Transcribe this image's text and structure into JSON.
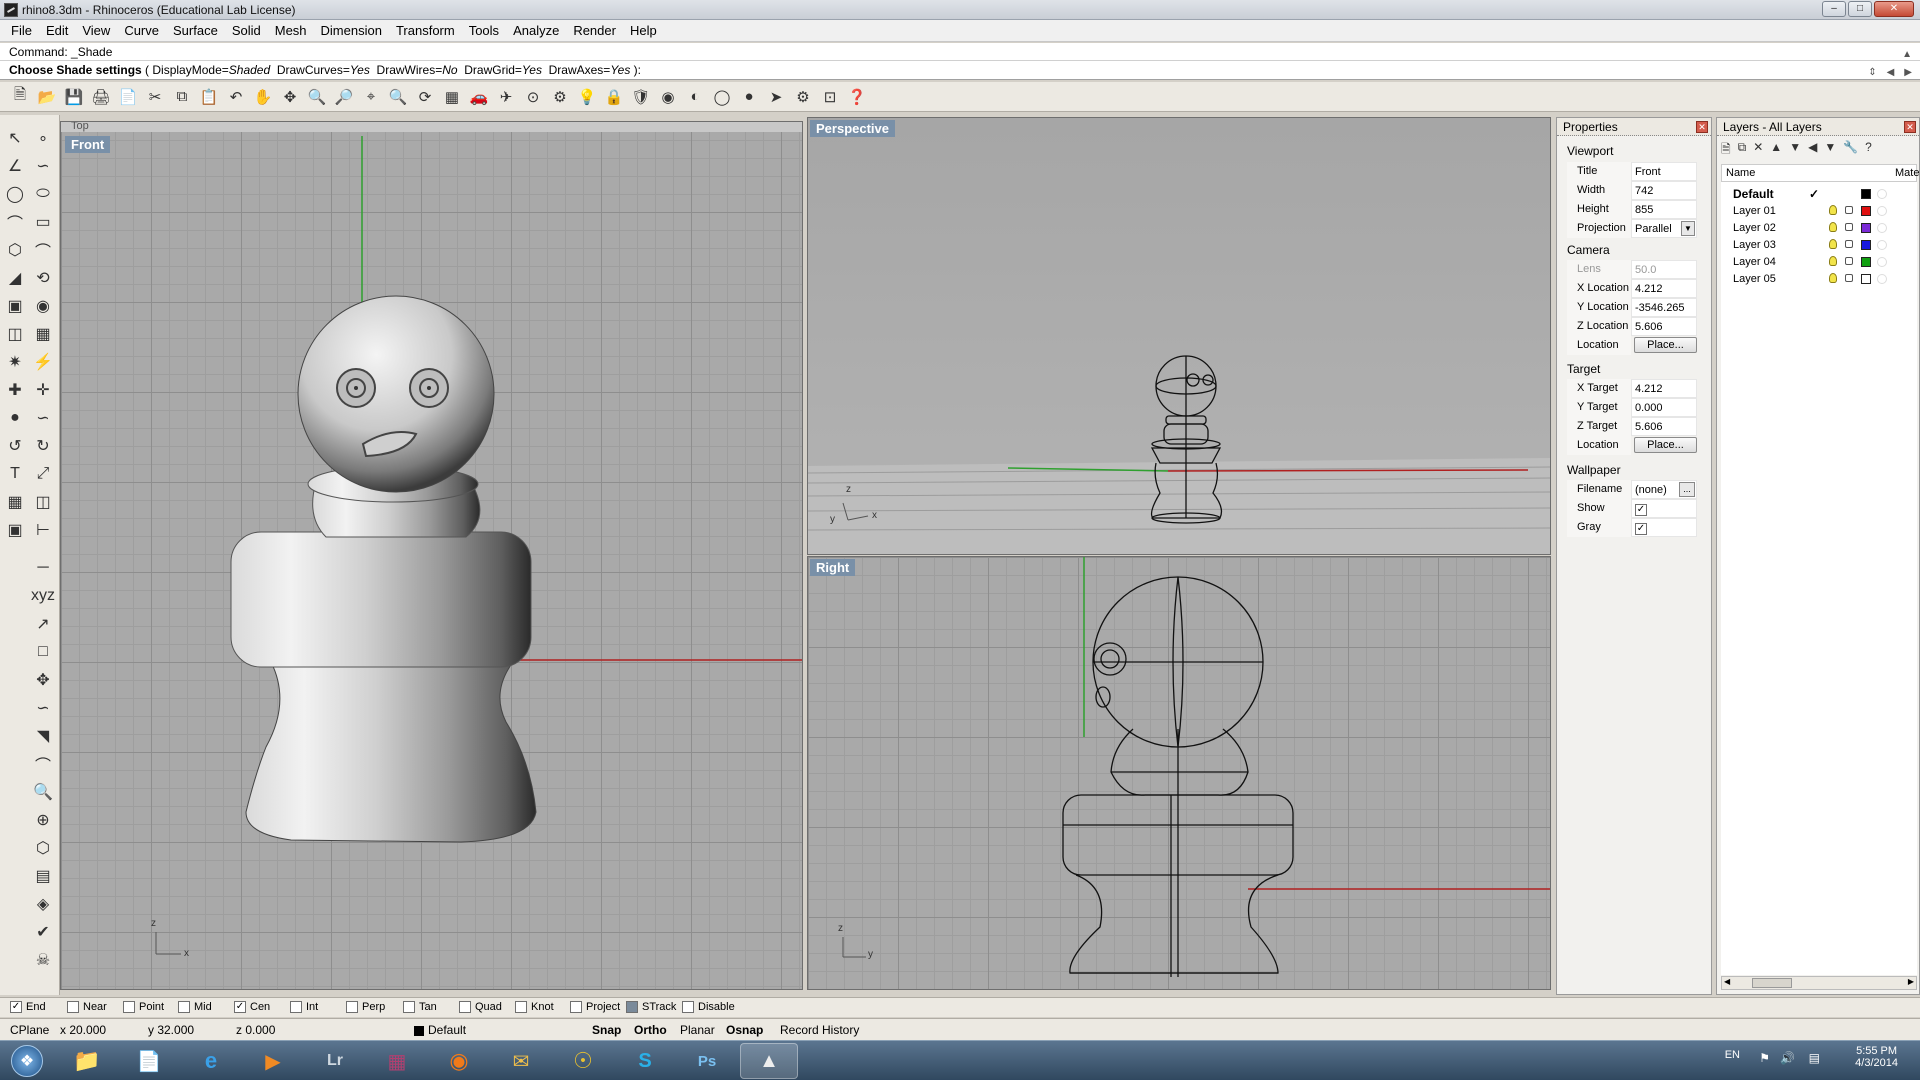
{
  "window": {
    "title": "rhino8.3dm - Rhinoceros (Educational Lab License)"
  },
  "menu": [
    "File",
    "Edit",
    "View",
    "Curve",
    "Surface",
    "Solid",
    "Mesh",
    "Dimension",
    "Transform",
    "Tools",
    "Analyze",
    "Render",
    "Help"
  ],
  "command": {
    "history": "Command: _Shade",
    "prompt": "Choose Shade settings",
    "open_paren": " ( ",
    "options": [
      {
        "name": "DisplayMode",
        "value": "Shaded"
      },
      {
        "name": "DrawCurves",
        "value": "Yes"
      },
      {
        "name": "DrawWires",
        "value": "No"
      },
      {
        "name": "DrawGrid",
        "value": "Yes"
      },
      {
        "name": "DrawAxes",
        "value": "Yes"
      }
    ],
    "close_paren": " ):"
  },
  "viewports": {
    "top_hidden_label": "Top",
    "front": {
      "label": "Front",
      "axis_x": "x",
      "axis_y": "z"
    },
    "perspective": {
      "label": "Perspective",
      "axis_x": "x",
      "axis_y": "y",
      "axis_z": "z"
    },
    "right": {
      "label": "Right",
      "axis_x": "y",
      "axis_y": "z"
    }
  },
  "properties": {
    "title": "Properties",
    "section_viewport": "Viewport",
    "section_camera": "Camera",
    "section_target": "Target",
    "section_wallpaper": "Wallpaper",
    "rows": [
      {
        "key": "Title",
        "value": "Front"
      },
      {
        "key": "Width",
        "value": "742"
      },
      {
        "key": "Height",
        "value": "855"
      },
      {
        "key": "Projection",
        "value": "Parallel"
      },
      {
        "key": "Lens Len...",
        "value": "50.0"
      },
      {
        "key": "X Location",
        "value": "4.212"
      },
      {
        "key": "Y Location",
        "value": "-3546.265"
      },
      {
        "key": "Z Location",
        "value": "5.606"
      },
      {
        "key": "Location",
        "value": "Place..."
      },
      {
        "key": "X Target",
        "value": "4.212"
      },
      {
        "key": "Y Target",
        "value": "0.000"
      },
      {
        "key": "Z Target",
        "value": "5.606"
      },
      {
        "key": "Location",
        "value": "Place..."
      },
      {
        "key": "Filename",
        "value": "(none)"
      },
      {
        "key": "Show",
        "value": "✓"
      },
      {
        "key": "Gray",
        "value": "✓"
      }
    ],
    "filename_btn": "..."
  },
  "layers": {
    "title": "Layers - All Layers",
    "col_name": "Name",
    "col_material": "Mater",
    "current_check": "✓",
    "items": [
      {
        "name": "Default",
        "color": "#000000"
      },
      {
        "name": "Layer 01",
        "color": "#e01010"
      },
      {
        "name": "Layer 02",
        "color": "#7b2ad6"
      },
      {
        "name": "Layer 03",
        "color": "#1818e0"
      },
      {
        "name": "Layer 04",
        "color": "#10a010"
      },
      {
        "name": "Layer 05",
        "color": "#ffffff"
      }
    ]
  },
  "osnaps": [
    {
      "label": "End",
      "checked": "✓"
    },
    {
      "label": "Near",
      "checked": ""
    },
    {
      "label": "Point",
      "checked": ""
    },
    {
      "label": "Mid",
      "checked": ""
    },
    {
      "label": "Cen",
      "checked": "✓"
    },
    {
      "label": "Int",
      "checked": ""
    },
    {
      "label": "Perp",
      "checked": ""
    },
    {
      "label": "Tan",
      "checked": ""
    },
    {
      "label": "Quad",
      "checked": ""
    },
    {
      "label": "Knot",
      "checked": ""
    },
    {
      "label": "Project",
      "checked": ""
    },
    {
      "label": "STrack",
      "checked": ""
    },
    {
      "label": "Disable",
      "checked": ""
    }
  ],
  "status": {
    "cplane": "CPlane",
    "x": "x 20.000",
    "y": "y 32.000",
    "z": "z 0.000",
    "layer": "Default",
    "snap": "Snap",
    "ortho": "Ortho",
    "planar": "Planar",
    "osnap": "Osnap",
    "record": "Record History"
  },
  "tray": {
    "lang": "EN",
    "time": "5:55 PM",
    "date": "4/3/2014"
  }
}
